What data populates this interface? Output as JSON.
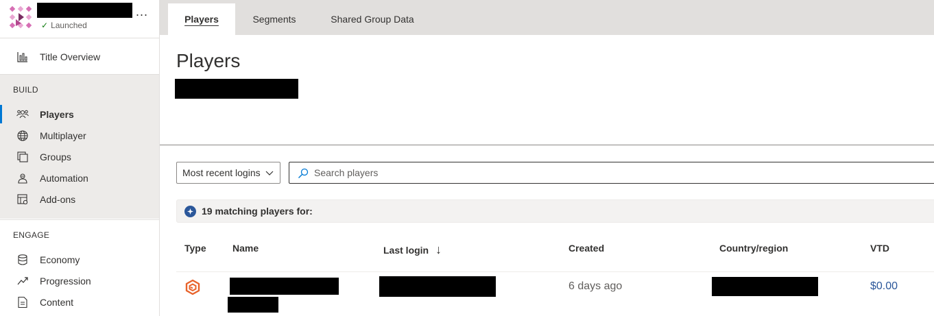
{
  "app": {
    "status": "Launched",
    "more_label": "..."
  },
  "sidebar": {
    "top_items": [
      {
        "label": "Title Overview",
        "icon": "bar-chart-icon"
      }
    ],
    "sections": [
      {
        "title": "BUILD",
        "items": [
          {
            "label": "Players",
            "icon": "players-icon",
            "active": true
          },
          {
            "label": "Multiplayer",
            "icon": "globe-icon"
          },
          {
            "label": "Groups",
            "icon": "groups-icon"
          },
          {
            "label": "Automation",
            "icon": "automation-icon"
          },
          {
            "label": "Add-ons",
            "icon": "addons-icon"
          }
        ]
      },
      {
        "title": "ENGAGE",
        "items": [
          {
            "label": "Economy",
            "icon": "database-icon"
          },
          {
            "label": "Progression",
            "icon": "trend-icon"
          },
          {
            "label": "Content",
            "icon": "document-icon"
          }
        ]
      }
    ]
  },
  "tabs": [
    {
      "label": "Players",
      "active": true
    },
    {
      "label": "Segments"
    },
    {
      "label": "Shared Group Data"
    }
  ],
  "page": {
    "title": "Players"
  },
  "filters": {
    "sort_value": "Most recent logins",
    "search_placeholder": "Search players"
  },
  "match_text": "19 matching players for:",
  "table": {
    "columns": [
      "Type",
      "Name",
      "Last login",
      "Created",
      "Country/region",
      "VTD"
    ],
    "sort_arrow": "↓",
    "rows": [
      {
        "created": "6 days ago",
        "vtd": "$0.00"
      }
    ]
  },
  "colors": {
    "accent": "#0078d4",
    "link": "#2b579a",
    "player_type_icon": "#e8632b"
  }
}
